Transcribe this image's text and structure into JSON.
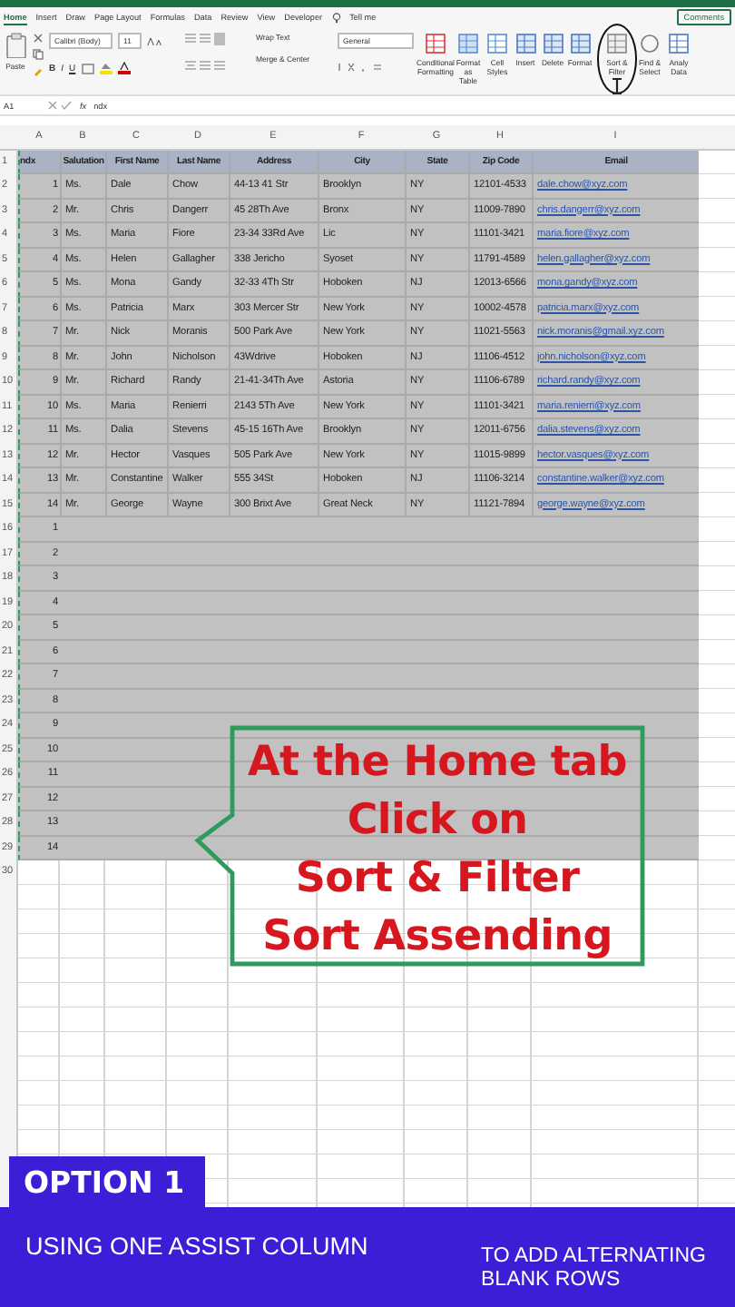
{
  "ribbon_tabs": [
    {
      "label": "Home",
      "selected": true
    },
    {
      "label": "Insert",
      "selected": false
    },
    {
      "label": "Draw",
      "selected": false
    },
    {
      "label": "Page Layout",
      "selected": false
    },
    {
      "label": "Formulas",
      "selected": false
    },
    {
      "label": "Data",
      "selected": false
    },
    {
      "label": "Review",
      "selected": false
    },
    {
      "label": "View",
      "selected": false
    },
    {
      "label": "Developer",
      "selected": false
    }
  ],
  "tell_me": "Tell me",
  "comments_button": "Comments",
  "ribbon": {
    "paste": "Paste",
    "font_name": "Calibri (Body)",
    "font_size": "11",
    "font_styles": [
      "B",
      "I",
      "U"
    ],
    "wrap_text": "Wrap Text",
    "merge": "Merge & Center",
    "number_format": "General",
    "large_buttons": [
      {
        "label": "Conditional Formatting",
        "kind": "conditional",
        "circled": false
      },
      {
        "label": "Format as Table",
        "kind": "table",
        "circled": false
      },
      {
        "label": "Cell Styles",
        "kind": "styles",
        "circled": false
      },
      {
        "label": "Insert",
        "kind": "insert",
        "circled": false
      },
      {
        "label": "Delete",
        "kind": "delete",
        "circled": false
      },
      {
        "label": "Format",
        "kind": "format",
        "circled": false
      },
      {
        "label": "Sort & Filter",
        "kind": "sort",
        "circled": true
      },
      {
        "label": "Find & Select",
        "kind": "find",
        "circled": false
      },
      {
        "label": "Analy Data",
        "kind": "analyze",
        "circled": false
      }
    ]
  },
  "formula_bar": {
    "name_box": "A1",
    "function_label": "fx",
    "value": "ndx"
  },
  "column_headers": [
    "A",
    "B",
    "C",
    "D",
    "E",
    "F",
    "G",
    "H",
    "I"
  ],
  "rows": [
    {
      "number": "1",
      "kind": "header",
      "selected": true,
      "cells": [
        "ndx",
        "Salutation",
        "First Name",
        "Last Name",
        "Address",
        "City",
        "State",
        "Zip Code",
        "Email"
      ]
    },
    {
      "number": "2",
      "kind": "data",
      "selected": true,
      "cells": [
        "1",
        "Ms.",
        "Dale",
        "Chow",
        "44-13 41 Str",
        "Brooklyn",
        "NY",
        "12101-4533",
        "dale.chow@xyz.com"
      ]
    },
    {
      "number": "3",
      "kind": "data",
      "selected": true,
      "cells": [
        "2",
        "Mr.",
        "Chris",
        "Dangerr",
        "45 28Th Ave",
        "Bronx",
        "NY",
        "11009-7890",
        "chris.dangerr@xyz.com"
      ]
    },
    {
      "number": "4",
      "kind": "data",
      "selected": true,
      "cells": [
        "3",
        "Ms.",
        "Maria",
        "Fiore",
        "23-34 33Rd Ave",
        "Lic",
        "NY",
        "11101-3421",
        "maria.fiore@xyz.com"
      ]
    },
    {
      "number": "5",
      "kind": "data",
      "selected": true,
      "cells": [
        "4",
        "Ms.",
        "Helen",
        "Gallagher",
        "338 Jericho",
        "Syoset",
        "NY",
        "11791-4589",
        "helen.gallagher@xyz.com"
      ]
    },
    {
      "number": "6",
      "kind": "data",
      "selected": true,
      "cells": [
        "5",
        "Ms.",
        "Mona",
        "Gandy",
        "32-33 4Th Str",
        "Hoboken",
        "NJ",
        "12013-6566",
        "mona.gandy@xyz.com"
      ]
    },
    {
      "number": "7",
      "kind": "data",
      "selected": true,
      "cells": [
        "6",
        "Ms.",
        "Patricia",
        "Marx",
        "303 Mercer Str",
        "New York",
        "NY",
        "10002-4578",
        "patricia.marx@xyz.com"
      ]
    },
    {
      "number": "8",
      "kind": "data",
      "selected": true,
      "cells": [
        "7",
        "Mr.",
        "Nick",
        "Moranis",
        "500 Park Ave",
        "New York",
        "NY",
        "11021-5563",
        "nick.moranis@gmail.xyz.com"
      ]
    },
    {
      "number": "9",
      "kind": "data",
      "selected": true,
      "cells": [
        "8",
        "Mr.",
        "John",
        "Nicholson",
        "43Wdrive",
        "Hoboken",
        "NJ",
        "11106-4512",
        "john.nicholson@xyz.com"
      ]
    },
    {
      "number": "10",
      "kind": "data",
      "selected": true,
      "cells": [
        "9",
        "Mr.",
        "Richard",
        "Randy",
        "21-41-34Th Ave",
        "Astoria",
        "NY",
        "11106-6789",
        "richard.randy@xyz.com"
      ]
    },
    {
      "number": "11",
      "kind": "data",
      "selected": true,
      "cells": [
        "10",
        "Ms.",
        "Maria",
        "Renierri",
        "2143 5Th Ave",
        "New York",
        "NY",
        "11101-3421",
        "maria.renierri@xyz.com"
      ]
    },
    {
      "number": "12",
      "kind": "data",
      "selected": true,
      "cells": [
        "11",
        "Ms.",
        "Dalia",
        "Stevens",
        "45-15 16Th Ave",
        "Brooklyn",
        "NY",
        "12011-6756",
        "dalia.stevens@xyz.com"
      ]
    },
    {
      "number": "13",
      "kind": "data",
      "selected": true,
      "cells": [
        "12",
        "Mr.",
        "Hector",
        "Vasques",
        "505 Park Ave",
        "New York",
        "NY",
        "11015-9899",
        "hector.vasques@xyz.com"
      ]
    },
    {
      "number": "14",
      "kind": "data",
      "selected": true,
      "cells": [
        "13",
        "Mr.",
        "Constantine",
        "Walker",
        "555 34St",
        "Hoboken",
        "NJ",
        "11106-3214",
        "constantine.walker@xyz.com"
      ]
    },
    {
      "number": "15",
      "kind": "data",
      "selected": true,
      "cells": [
        "14",
        "Mr.",
        "George",
        "Wayne",
        "300 Brixt Ave",
        "Great Neck",
        "NY",
        "11121-7894",
        "george.wayne@xyz.com"
      ]
    },
    {
      "number": "16",
      "kind": "data",
      "selected": true,
      "cells": [
        "1"
      ]
    },
    {
      "number": "17",
      "kind": "data",
      "selected": true,
      "cells": [
        "2"
      ]
    },
    {
      "number": "18",
      "kind": "data",
      "selected": true,
      "cells": [
        "3"
      ]
    },
    {
      "number": "19",
      "kind": "data",
      "selected": true,
      "cells": [
        "4"
      ]
    },
    {
      "number": "20",
      "kind": "data",
      "selected": true,
      "cells": [
        "5"
      ]
    },
    {
      "number": "21",
      "kind": "data",
      "selected": true,
      "cells": [
        "6"
      ]
    },
    {
      "number": "22",
      "kind": "data",
      "selected": true,
      "cells": [
        "7"
      ]
    },
    {
      "number": "23",
      "kind": "data",
      "selected": true,
      "cells": [
        "8"
      ]
    },
    {
      "number": "24",
      "kind": "data",
      "selected": true,
      "cells": [
        "9"
      ]
    },
    {
      "number": "25",
      "kind": "data",
      "selected": true,
      "cells": [
        "10"
      ]
    },
    {
      "number": "26",
      "kind": "data",
      "selected": true,
      "cells": [
        "11"
      ]
    },
    {
      "number": "27",
      "kind": "data",
      "selected": true,
      "cells": [
        "12"
      ]
    },
    {
      "number": "28",
      "kind": "data",
      "selected": true,
      "cells": [
        "13"
      ]
    },
    {
      "number": "29",
      "kind": "data",
      "selected": true,
      "cells": [
        "14"
      ]
    },
    {
      "number": "30",
      "kind": "data",
      "selected": false,
      "cells": []
    }
  ],
  "callout": {
    "lines": [
      "At the Home tab",
      "Click on",
      "Sort & Filter",
      "Sort Assending"
    ]
  },
  "banner": {
    "tab": "OPTION 1",
    "subtitle": "USING ONE ASSIST COLUMN",
    "note": "TO ADD ALTERNATING BLANK ROWS"
  }
}
